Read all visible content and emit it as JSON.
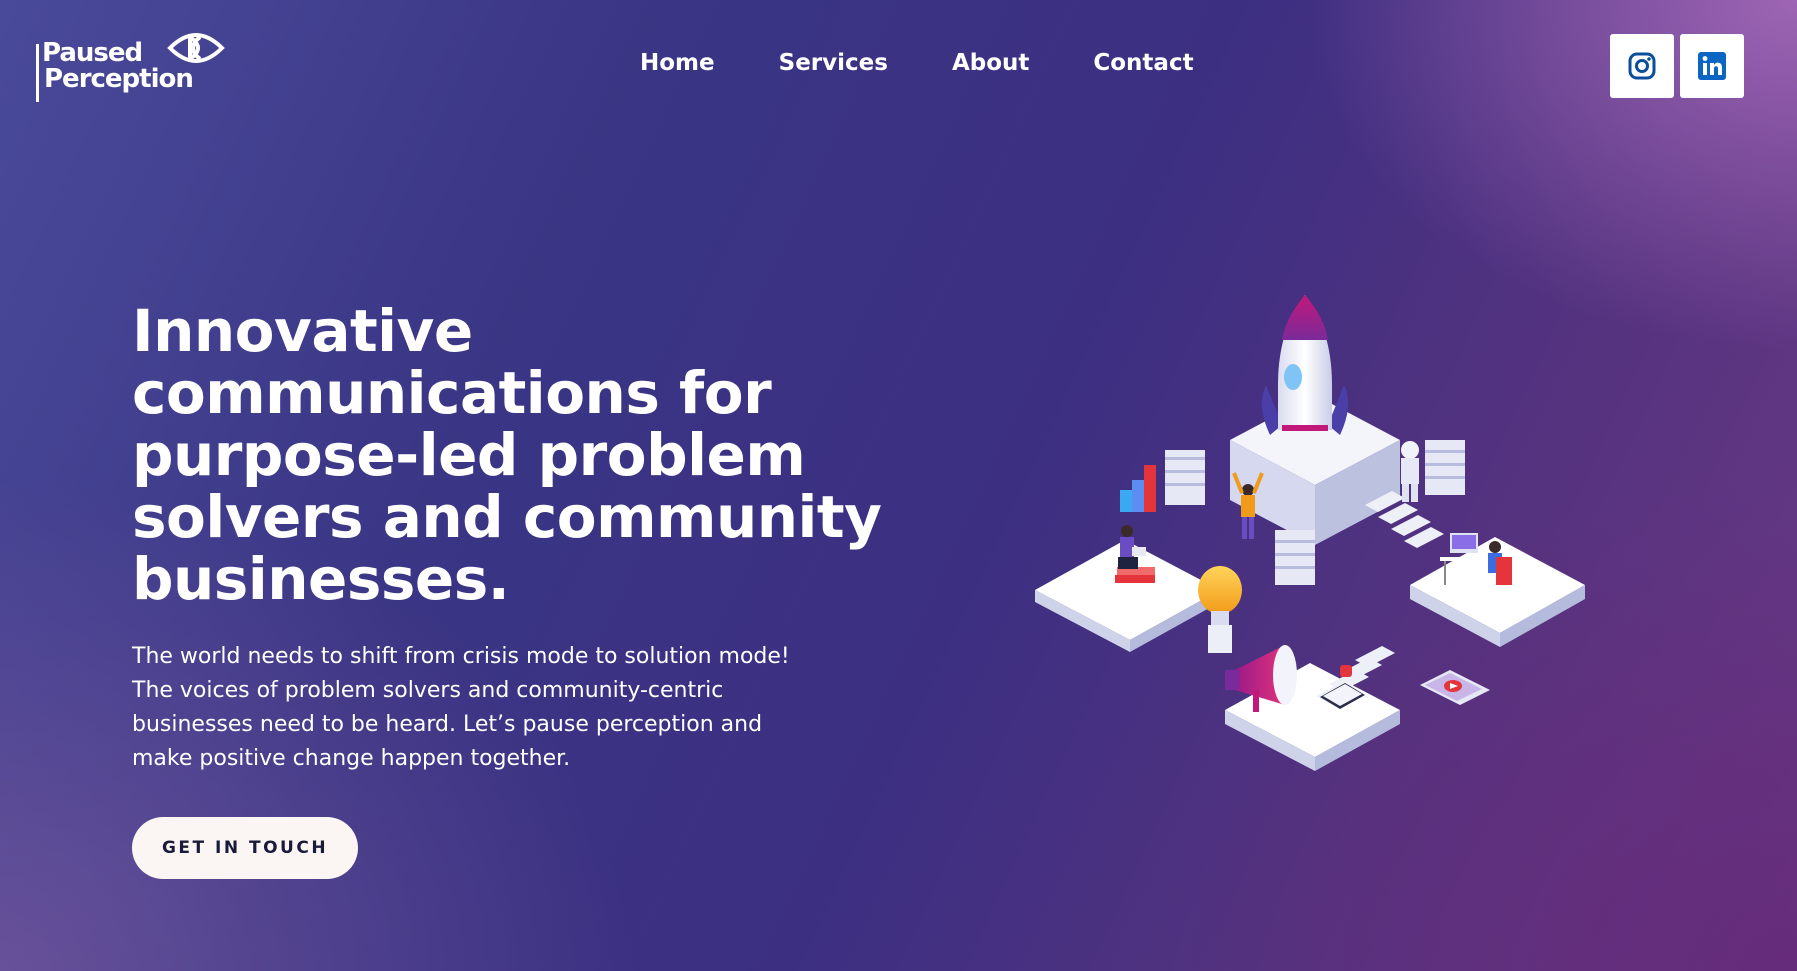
{
  "brand": {
    "line1": "Paused",
    "line2": "Perception"
  },
  "nav": {
    "items": [
      {
        "label": "Home"
      },
      {
        "label": "Services"
      },
      {
        "label": "About"
      },
      {
        "label": "Contact"
      }
    ]
  },
  "social": {
    "instagram_icon": "instagram-icon",
    "linkedin_icon": "linkedin-icon",
    "linkedin_color": "#0a66c2"
  },
  "hero": {
    "title": "Innovative communications for purpose-led problem solvers and community businesses.",
    "body_lines": [
      "The world needs to shift from crisis mode to solution mode!",
      "The voices of problem solvers and community-centric",
      "businesses need to be heard. Let’s pause perception and",
      "make positive change happen together."
    ],
    "cta_label": "GET IN TOUCH"
  }
}
